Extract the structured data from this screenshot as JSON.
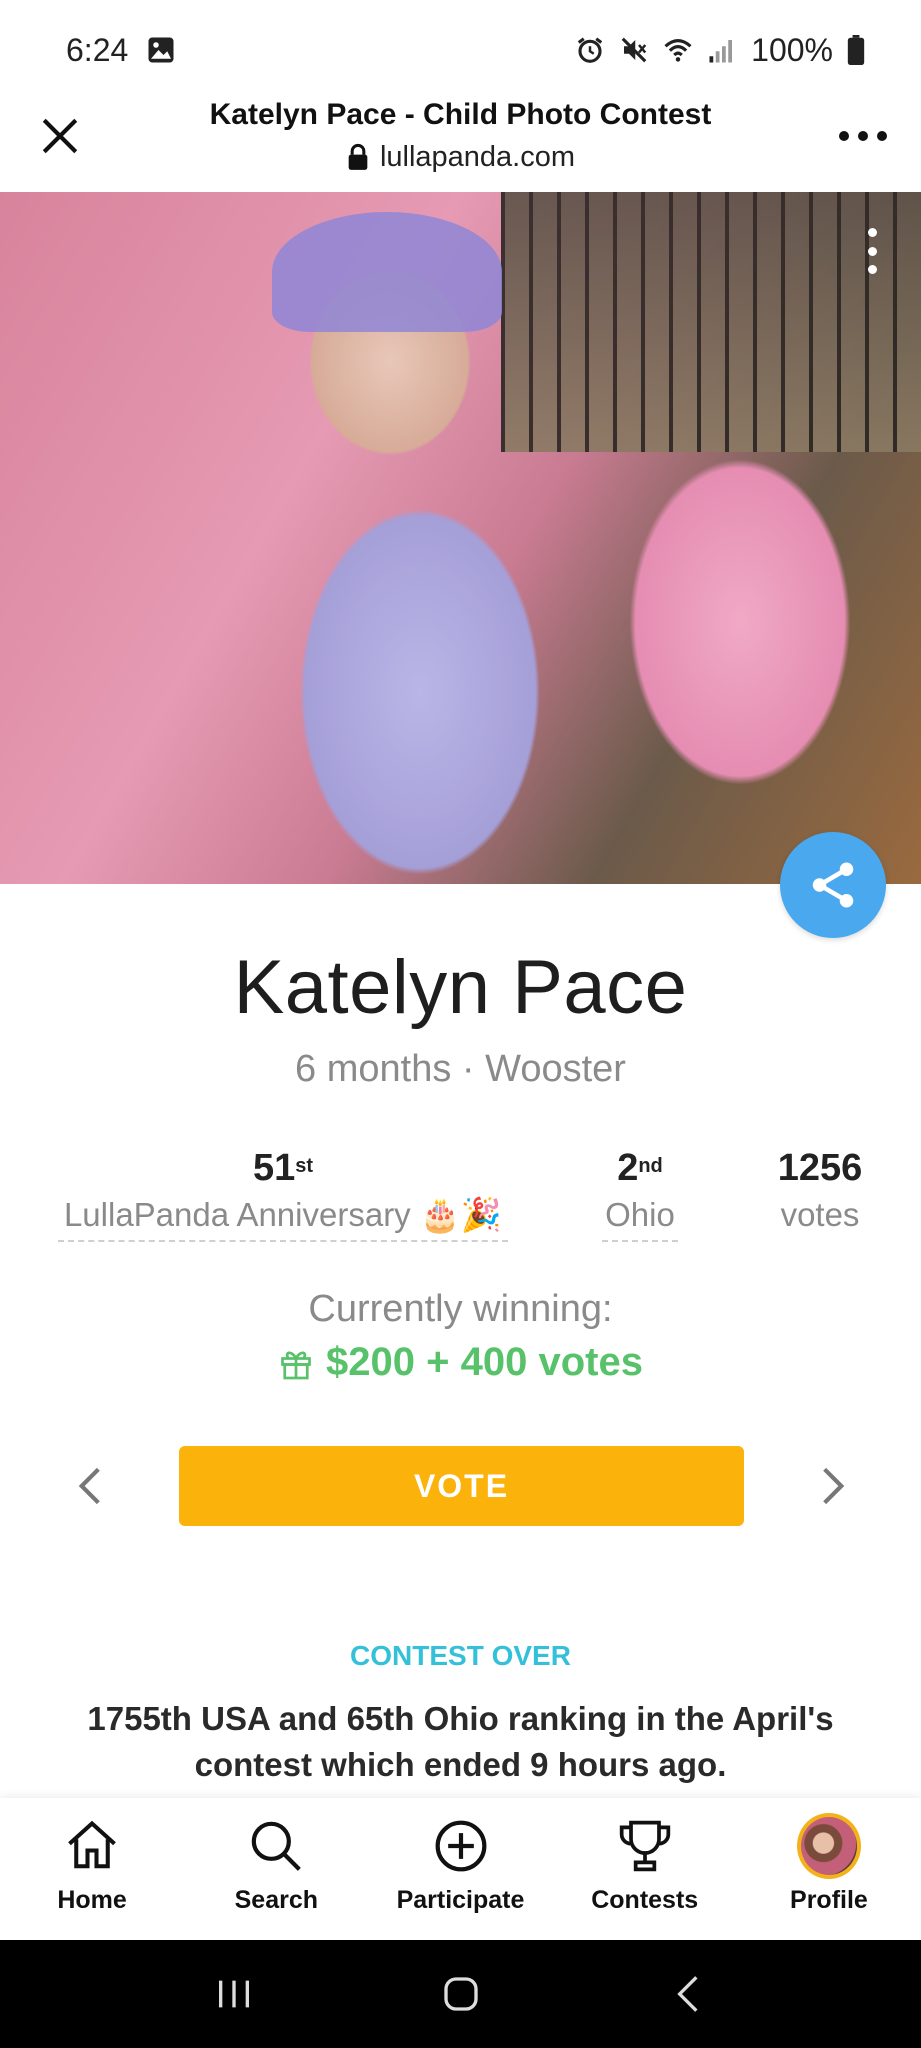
{
  "status_bar": {
    "time": "6:24",
    "battery": "100%"
  },
  "browser": {
    "page_title": "Katelyn Pace - Child Photo Contest",
    "domain": "lullapanda.com"
  },
  "profile": {
    "name": "Katelyn Pace",
    "age": "6 months",
    "separator": "·",
    "city": "Wooster"
  },
  "stats": {
    "anniversary_rank": "51",
    "anniversary_suffix": "st",
    "anniversary_label": "LullaPanda Anniversary 🎂🎉",
    "state_rank": "2",
    "state_suffix": "nd",
    "state_label": "Ohio",
    "votes_count": "1256",
    "votes_label": "votes"
  },
  "winning": {
    "label": "Currently winning:",
    "prize": "$200 + 400 votes"
  },
  "vote_button_label": "VOTE",
  "contest": {
    "status": "CONTEST OVER",
    "ranking_text": "1755th USA and 65th Ohio ranking in the April's contest which ended 9 hours ago."
  },
  "bottom_nav": {
    "items": [
      {
        "label": "Home",
        "icon": "home-icon"
      },
      {
        "label": "Search",
        "icon": "search-icon"
      },
      {
        "label": "Participate",
        "icon": "plus-circle-icon"
      },
      {
        "label": "Contests",
        "icon": "trophy-icon"
      },
      {
        "label": "Profile",
        "icon": "avatar"
      }
    ]
  },
  "colors": {
    "vote_button": "#fbb30c",
    "share_button": "#4aa9ee",
    "prize_green": "#57c26a",
    "contest_over_cyan": "#34c0d8",
    "avatar_ring": "#f3b21a"
  }
}
